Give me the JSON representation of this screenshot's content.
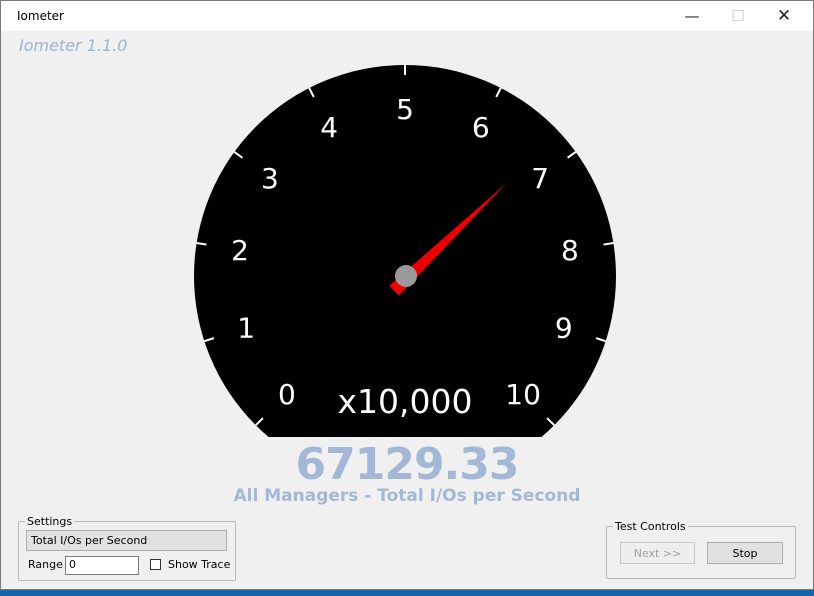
{
  "window": {
    "title": "Iometer",
    "close_symbol": "✕",
    "minimize_symbol": "—",
    "maximize_symbol": "☐"
  },
  "app": {
    "version_label": "Iometer 1.1.0"
  },
  "gauge": {
    "tick_labels": [
      "0",
      "1",
      "2",
      "3",
      "4",
      "5",
      "6",
      "7",
      "8",
      "9",
      "10"
    ],
    "multiplier_label": "x10,000",
    "value": 67129.33,
    "scale_max": 10,
    "scale_factor": 10000,
    "colors": {
      "face": "#000000",
      "text": "#ffffff",
      "needle": "#ee0000",
      "hub": "#9a9a9a"
    }
  },
  "readout": {
    "value_text": "67129.33",
    "caption": "All Managers - Total I/Os per Second",
    "color": "#a3b8d6"
  },
  "settings": {
    "legend": "Settings",
    "metric_button_label": "Total I/Os per Second",
    "range_label": "Range",
    "range_value": "0",
    "show_trace_label": "Show Trace",
    "show_trace_checked": false
  },
  "test_controls": {
    "legend": "Test Controls",
    "next_label": "Next >>",
    "next_enabled": false,
    "stop_label": "Stop"
  }
}
